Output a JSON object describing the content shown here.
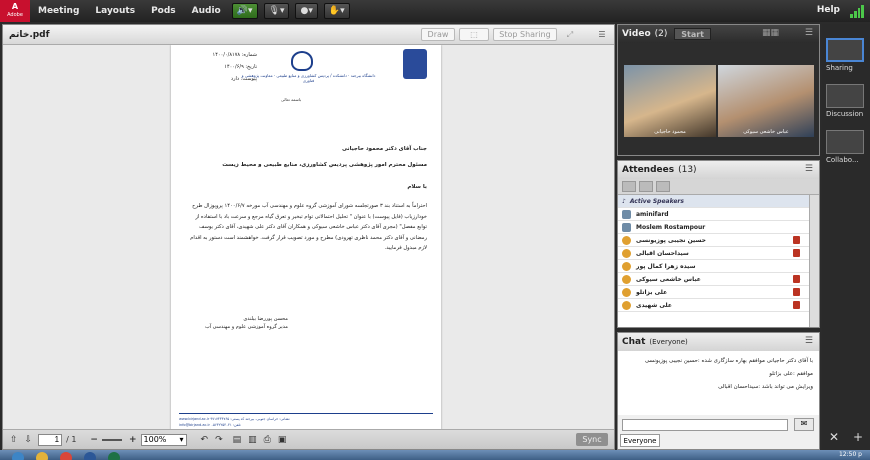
{
  "menubar": {
    "brand": "Adobe",
    "items": [
      "Meeting",
      "Layouts",
      "Pods",
      "Audio"
    ],
    "help": "Help"
  },
  "share": {
    "title": "خاتم.pdf",
    "draw_label": "Draw",
    "stop_label": "Stop Sharing"
  },
  "letter": {
    "meta": [
      "شماره: ۱۴۰۰/۰/۸۱۷۸",
      "تاریخ: ۱۴۰۰/۶/۹",
      "پیوست: دارد"
    ],
    "header": "دانشگاه بیرجند · دانشکده / پردیس کشاورزی و منابع طبیعی · معاونت پژوهشی و فناوری",
    "basmala": "باسمه تعالی",
    "to_line1": "جناب آقای دکتر محمود حاجیانی",
    "to_line2": "مسئول محترم امور پژوهشی پردیس کشاورزی، منابع طبیعی و محیط زیست",
    "greeting": "با سلام",
    "body": "احتراماً به استناد بند ۳ صورتجلسه شورای آموزشی گروه علوم و مهندسی آب مورخه ۱۴۰۰/۶/۷ پروپوزال طرح خودارزیاب (فایل پیوست) با عنوان \" تحلیل احتمالاتی توام تبخیر و تعرق گیاه مرجع و سرعت باد با استفاده از توابع مفصل\" (مجری آقای دکتر عباس خاشعی سیوکی و همکاران آقای دکتر علی شهیدی، آقای دکتر یوسف رمضانی و آقای دکتر محمد ناظری تهرودی) مطرح و مورد تصویب قرار گرفت. خواهشمند است دستور به اقدام لازم مبذول فرمایید.",
    "signer": "محسن پوررضا بیلندی",
    "signer_title": "مدیر گروه آموزشی علوم و مهندسی آب",
    "footer1": "www.birjand.ac.ir    نشانی: خراسان جنوبی، بیرجند    کد پستی: ۹۷۱۷۴۳۴۷۶۵",
    "footer2": "info@birjand.ac.ir    تلفن: ۰۵۶۳۲۲۵۴۰۴۱"
  },
  "share_footer": {
    "page_current": "1",
    "page_total": "/ 1",
    "zoom": "100%",
    "sync_label": "Sync"
  },
  "video": {
    "title": "Video",
    "count": "(2)",
    "start_label": "Start",
    "participants": [
      "محمود حاجیانی",
      "عباس خاشعی سیوکی"
    ]
  },
  "attendees": {
    "title": "Attendees",
    "count": "(13)",
    "section_label": "Active Speakers",
    "rows": [
      "aminifard",
      "Moslem Rostampour",
      "حسین نجیبی پوزیونسی",
      "سیداحسان اقبالی",
      "سیده زهرا کمال پور",
      "عباس خاشعی سیوکی",
      "علی بزاتلو",
      "علی شهیدی"
    ]
  },
  "chat": {
    "title": "Chat",
    "scope": "(Everyone)",
    "messages": [
      "با آقای دکتر حاجیانی موافقم بهاره سازگاری شده :حسین نجیبی پوزیونسی",
      "موافقم :علی بزاتلو",
      "ویرایش می تواند باشد :سیداحسان اقبالی"
    ],
    "tab_label": "Everyone"
  },
  "layouts": {
    "items": [
      "Sharing",
      "Discussion",
      "Collabo..."
    ]
  },
  "taskbar": {
    "clock": "12:50 p"
  },
  "colors": {
    "adobe_red": "#c8102e",
    "selection_blue": "#4a86d4",
    "audio_green": "#4d8f35"
  }
}
